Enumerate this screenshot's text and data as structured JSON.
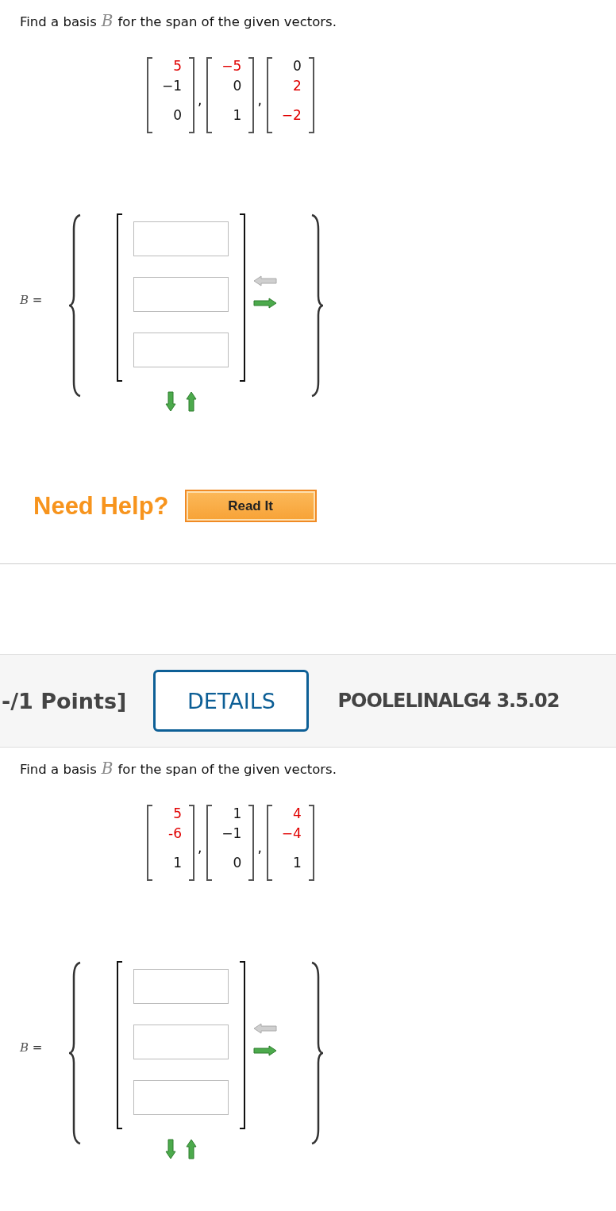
{
  "problems": [
    {
      "prompt": {
        "before": "Find a basis",
        "symbol": "B",
        "after": "for the span of the given vectors."
      },
      "separator": ",",
      "vectors": [
        [
          {
            "value": "5",
            "highlighted": true
          },
          {
            "value": "−1",
            "highlighted": false
          },
          {
            "value": "0",
            "highlighted": false
          }
        ],
        [
          {
            "value": "−5",
            "highlighted": true
          },
          {
            "value": "0",
            "highlighted": false
          },
          {
            "value": "1",
            "highlighted": false
          }
        ],
        [
          {
            "value": "0",
            "highlighted": false
          },
          {
            "value": "2",
            "highlighted": true
          },
          {
            "value": "−2",
            "highlighted": true
          }
        ]
      ],
      "answer": {
        "symbol": "B",
        "equals": "=",
        "fields": [
          {
            "disabled": false
          },
          {
            "disabled": false
          },
          {
            "disabled": false
          }
        ],
        "remove_column_disabled": true,
        "add_column_disabled": false,
        "add_row_disabled": false,
        "remove_row_disabled": false
      },
      "help": {
        "label": "Need Help?",
        "button": "Read It"
      }
    },
    {
      "header": {
        "points": "-/1 Points]",
        "details": "DETAILS",
        "code": "POOLELINALG4 3.5.02"
      },
      "prompt": {
        "before": "Find a basis",
        "symbol": "B",
        "after": "for the span of the given vectors."
      },
      "separator": ",",
      "vectors": [
        [
          {
            "value": "5",
            "highlighted": true
          },
          {
            "value": "-6",
            "highlighted": true
          },
          {
            "value": "1",
            "highlighted": false
          }
        ],
        [
          {
            "value": "1",
            "highlighted": false
          },
          {
            "value": "−1",
            "highlighted": false
          },
          {
            "value": "0",
            "highlighted": false
          }
        ],
        [
          {
            "value": "4",
            "highlighted": true
          },
          {
            "value": "−4",
            "highlighted": true
          },
          {
            "value": "1",
            "highlighted": false
          }
        ]
      ],
      "answer": {
        "symbol": "B",
        "equals": "=",
        "fields": [
          {
            "disabled": false
          },
          {
            "disabled": false
          },
          {
            "disabled": false
          }
        ],
        "remove_column_disabled": true,
        "add_column_disabled": false,
        "add_row_disabled": false,
        "remove_row_disabled": false
      }
    }
  ]
}
